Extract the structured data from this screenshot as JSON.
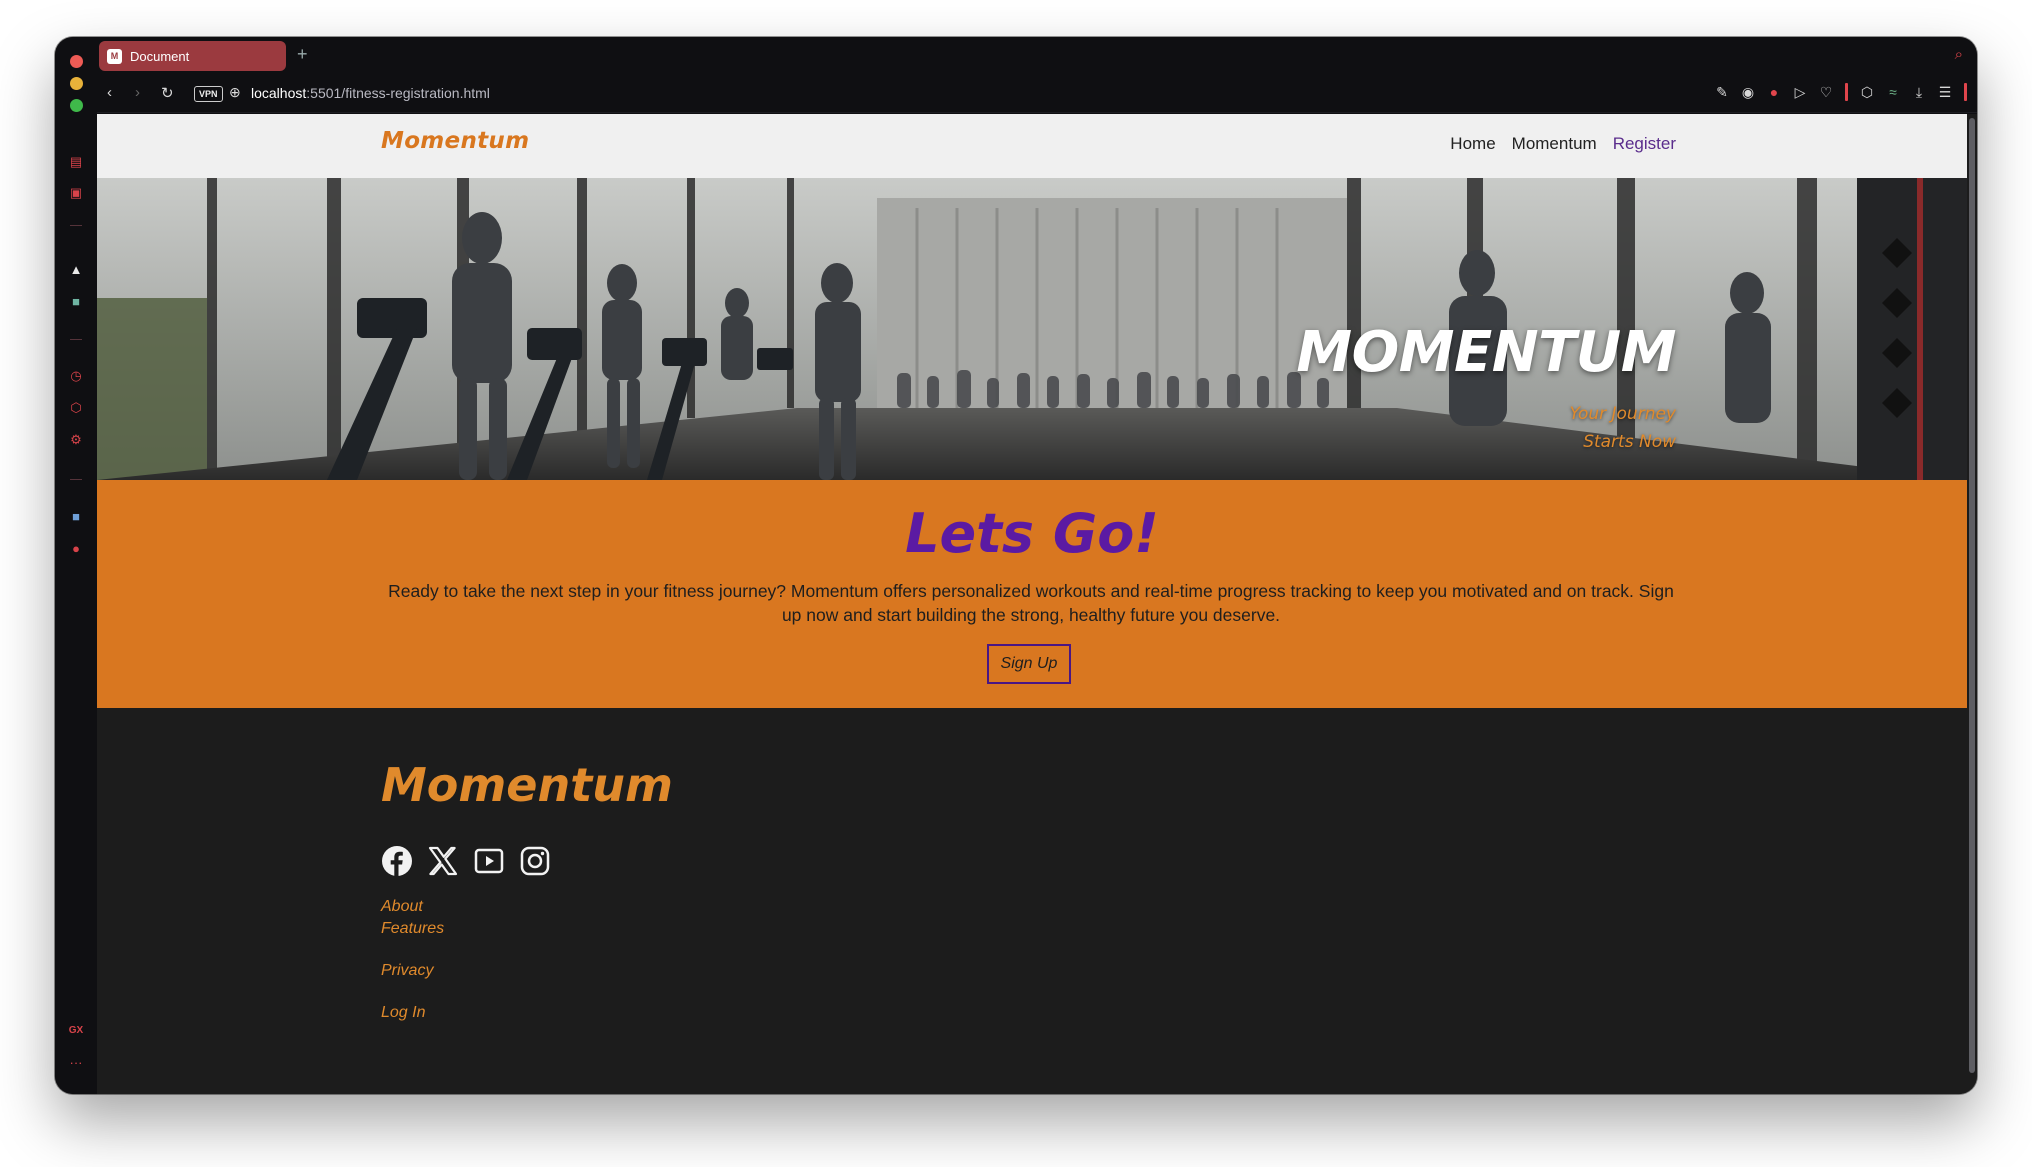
{
  "browser": {
    "tab_title": "Document",
    "tab_favicon": "M",
    "new_tab": "+",
    "vpn_label": "VPN",
    "url_host": "localhost",
    "url_rest": ":5501/fitness-registration.html"
  },
  "site": {
    "brand": "Momentum",
    "nav": [
      {
        "label": "Home"
      },
      {
        "label": "Momentum"
      },
      {
        "label": "Register"
      }
    ]
  },
  "hero": {
    "title": "MOMENTUM",
    "tagline_line1": "Your Journey",
    "tagline_line2": "Starts Now"
  },
  "cta": {
    "title": "Lets Go!",
    "text": "Ready to take the next step in your fitness journey? Momentum offers personalized workouts and real-time progress tracking to keep you motivated and on track. Sign up now and start building the strong, healthy future you deserve.",
    "button": "Sign Up"
  },
  "footer": {
    "brand": "Momentum",
    "socials": [
      "facebook-icon",
      "x-icon",
      "youtube-icon",
      "instagram-icon"
    ],
    "links": [
      {
        "label": "About"
      },
      {
        "label": "Features"
      },
      {
        "label": "Privacy"
      },
      {
        "label": "Log In"
      }
    ]
  },
  "colors": {
    "brand_orange": "#d97720",
    "accent_purple": "#5b1aa3",
    "footer_bg": "#1c1c1c",
    "nav_bg": "#f0f0f0"
  }
}
